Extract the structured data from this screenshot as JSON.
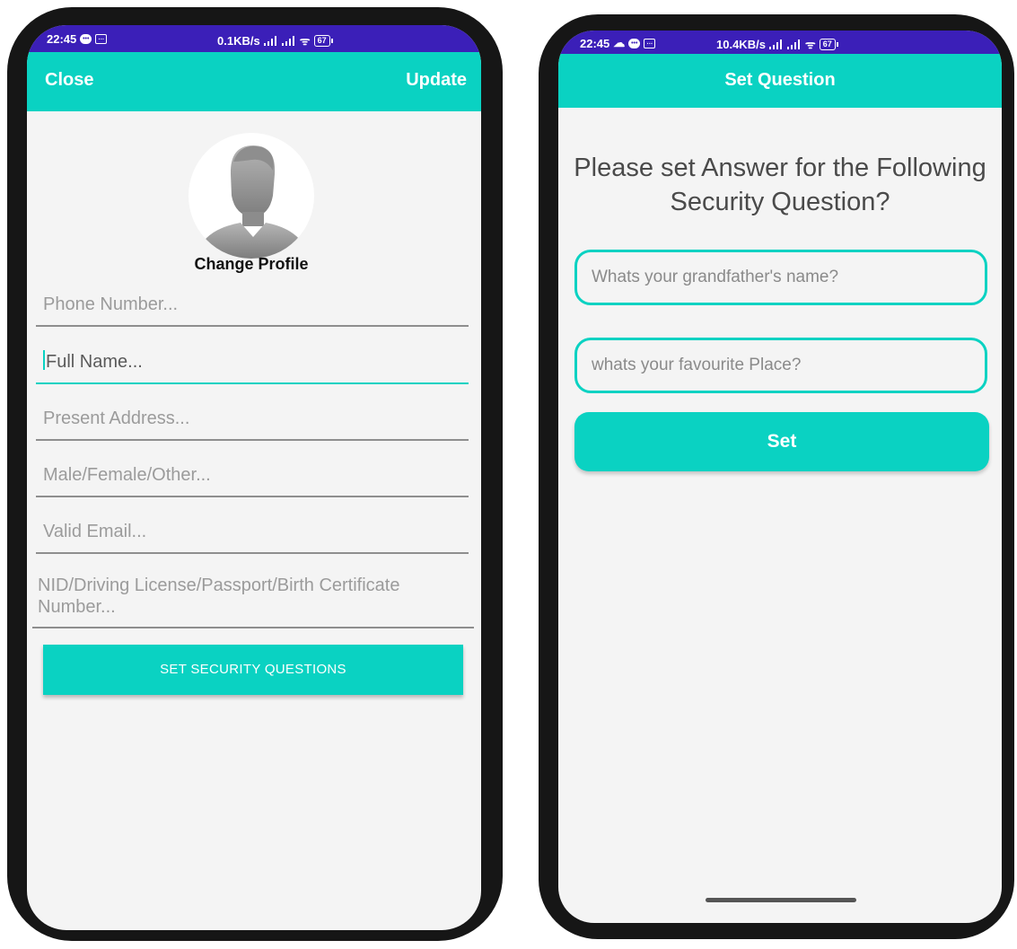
{
  "left_screen": {
    "status_bar": {
      "time": "22:45",
      "network_speed": "0.1KB/s",
      "battery": "67",
      "icons": [
        "message-bubble-icon",
        "chat-icon",
        "signal-icon",
        "signal-icon",
        "wifi-icon",
        "battery-icon"
      ]
    },
    "app_bar": {
      "close_label": "Close",
      "update_label": "Update"
    },
    "avatar_icon": "default-person-avatar",
    "change_profile_label": "Change Profile",
    "fields": {
      "phone": {
        "placeholder": "Phone Number..."
      },
      "full_name": {
        "placeholder": "Full Name...",
        "focused": true
      },
      "address": {
        "placeholder": "Present Address..."
      },
      "gender": {
        "placeholder": "Male/Female/Other..."
      },
      "email": {
        "placeholder": "Valid Email..."
      },
      "id_number": {
        "placeholder": "NID/Driving License/Passport/Birth Certificate Number..."
      }
    },
    "security_button_label": "SET SECURITY QUESTIONS"
  },
  "right_screen": {
    "status_bar": {
      "time": "22:45",
      "network_speed": "10.4KB/s",
      "battery": "67",
      "icons": [
        "cloud-icon",
        "message-bubble-icon",
        "chat-icon",
        "signal-icon",
        "signal-icon",
        "wifi-icon",
        "battery-icon"
      ]
    },
    "app_bar": {
      "title": "Set Question"
    },
    "heading": "Please set Answer for the Following Security Question?",
    "question1_placeholder": "Whats your grandfather's name?",
    "question2_placeholder": "whats your favourite Place?",
    "set_button_label": "Set"
  },
  "colors": {
    "status_bar": "#3b1fb8",
    "accent": "#0ad2c2",
    "background": "#f4f4f4",
    "phone_frame": "#161616"
  }
}
